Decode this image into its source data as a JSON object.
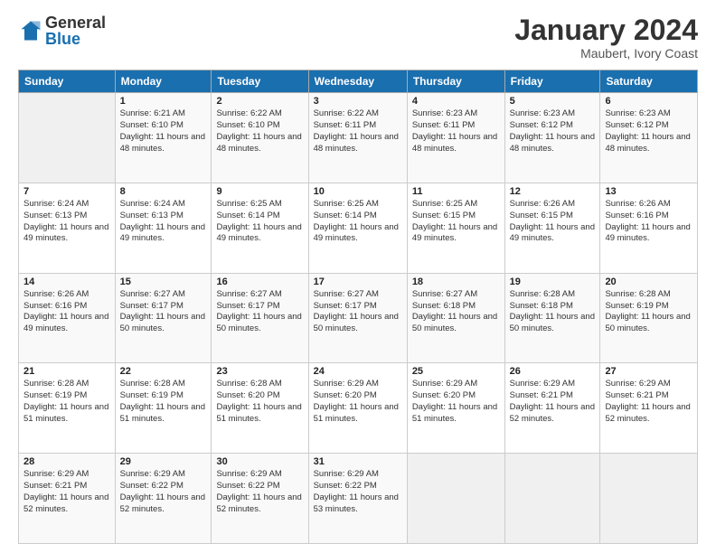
{
  "logo": {
    "general": "General",
    "blue": "Blue"
  },
  "title": "January 2024",
  "location": "Maubert, Ivory Coast",
  "days_of_week": [
    "Sunday",
    "Monday",
    "Tuesday",
    "Wednesday",
    "Thursday",
    "Friday",
    "Saturday"
  ],
  "weeks": [
    [
      {
        "day": "",
        "sunrise": "",
        "sunset": "",
        "daylight": ""
      },
      {
        "day": "1",
        "sunrise": "Sunrise: 6:21 AM",
        "sunset": "Sunset: 6:10 PM",
        "daylight": "Daylight: 11 hours and 48 minutes."
      },
      {
        "day": "2",
        "sunrise": "Sunrise: 6:22 AM",
        "sunset": "Sunset: 6:10 PM",
        "daylight": "Daylight: 11 hours and 48 minutes."
      },
      {
        "day": "3",
        "sunrise": "Sunrise: 6:22 AM",
        "sunset": "Sunset: 6:11 PM",
        "daylight": "Daylight: 11 hours and 48 minutes."
      },
      {
        "day": "4",
        "sunrise": "Sunrise: 6:23 AM",
        "sunset": "Sunset: 6:11 PM",
        "daylight": "Daylight: 11 hours and 48 minutes."
      },
      {
        "day": "5",
        "sunrise": "Sunrise: 6:23 AM",
        "sunset": "Sunset: 6:12 PM",
        "daylight": "Daylight: 11 hours and 48 minutes."
      },
      {
        "day": "6",
        "sunrise": "Sunrise: 6:23 AM",
        "sunset": "Sunset: 6:12 PM",
        "daylight": "Daylight: 11 hours and 48 minutes."
      }
    ],
    [
      {
        "day": "7",
        "sunrise": "Sunrise: 6:24 AM",
        "sunset": "Sunset: 6:13 PM",
        "daylight": "Daylight: 11 hours and 49 minutes."
      },
      {
        "day": "8",
        "sunrise": "Sunrise: 6:24 AM",
        "sunset": "Sunset: 6:13 PM",
        "daylight": "Daylight: 11 hours and 49 minutes."
      },
      {
        "day": "9",
        "sunrise": "Sunrise: 6:25 AM",
        "sunset": "Sunset: 6:14 PM",
        "daylight": "Daylight: 11 hours and 49 minutes."
      },
      {
        "day": "10",
        "sunrise": "Sunrise: 6:25 AM",
        "sunset": "Sunset: 6:14 PM",
        "daylight": "Daylight: 11 hours and 49 minutes."
      },
      {
        "day": "11",
        "sunrise": "Sunrise: 6:25 AM",
        "sunset": "Sunset: 6:15 PM",
        "daylight": "Daylight: 11 hours and 49 minutes."
      },
      {
        "day": "12",
        "sunrise": "Sunrise: 6:26 AM",
        "sunset": "Sunset: 6:15 PM",
        "daylight": "Daylight: 11 hours and 49 minutes."
      },
      {
        "day": "13",
        "sunrise": "Sunrise: 6:26 AM",
        "sunset": "Sunset: 6:16 PM",
        "daylight": "Daylight: 11 hours and 49 minutes."
      }
    ],
    [
      {
        "day": "14",
        "sunrise": "Sunrise: 6:26 AM",
        "sunset": "Sunset: 6:16 PM",
        "daylight": "Daylight: 11 hours and 49 minutes."
      },
      {
        "day": "15",
        "sunrise": "Sunrise: 6:27 AM",
        "sunset": "Sunset: 6:17 PM",
        "daylight": "Daylight: 11 hours and 50 minutes."
      },
      {
        "day": "16",
        "sunrise": "Sunrise: 6:27 AM",
        "sunset": "Sunset: 6:17 PM",
        "daylight": "Daylight: 11 hours and 50 minutes."
      },
      {
        "day": "17",
        "sunrise": "Sunrise: 6:27 AM",
        "sunset": "Sunset: 6:17 PM",
        "daylight": "Daylight: 11 hours and 50 minutes."
      },
      {
        "day": "18",
        "sunrise": "Sunrise: 6:27 AM",
        "sunset": "Sunset: 6:18 PM",
        "daylight": "Daylight: 11 hours and 50 minutes."
      },
      {
        "day": "19",
        "sunrise": "Sunrise: 6:28 AM",
        "sunset": "Sunset: 6:18 PM",
        "daylight": "Daylight: 11 hours and 50 minutes."
      },
      {
        "day": "20",
        "sunrise": "Sunrise: 6:28 AM",
        "sunset": "Sunset: 6:19 PM",
        "daylight": "Daylight: 11 hours and 50 minutes."
      }
    ],
    [
      {
        "day": "21",
        "sunrise": "Sunrise: 6:28 AM",
        "sunset": "Sunset: 6:19 PM",
        "daylight": "Daylight: 11 hours and 51 minutes."
      },
      {
        "day": "22",
        "sunrise": "Sunrise: 6:28 AM",
        "sunset": "Sunset: 6:19 PM",
        "daylight": "Daylight: 11 hours and 51 minutes."
      },
      {
        "day": "23",
        "sunrise": "Sunrise: 6:28 AM",
        "sunset": "Sunset: 6:20 PM",
        "daylight": "Daylight: 11 hours and 51 minutes."
      },
      {
        "day": "24",
        "sunrise": "Sunrise: 6:29 AM",
        "sunset": "Sunset: 6:20 PM",
        "daylight": "Daylight: 11 hours and 51 minutes."
      },
      {
        "day": "25",
        "sunrise": "Sunrise: 6:29 AM",
        "sunset": "Sunset: 6:20 PM",
        "daylight": "Daylight: 11 hours and 51 minutes."
      },
      {
        "day": "26",
        "sunrise": "Sunrise: 6:29 AM",
        "sunset": "Sunset: 6:21 PM",
        "daylight": "Daylight: 11 hours and 52 minutes."
      },
      {
        "day": "27",
        "sunrise": "Sunrise: 6:29 AM",
        "sunset": "Sunset: 6:21 PM",
        "daylight": "Daylight: 11 hours and 52 minutes."
      }
    ],
    [
      {
        "day": "28",
        "sunrise": "Sunrise: 6:29 AM",
        "sunset": "Sunset: 6:21 PM",
        "daylight": "Daylight: 11 hours and 52 minutes."
      },
      {
        "day": "29",
        "sunrise": "Sunrise: 6:29 AM",
        "sunset": "Sunset: 6:22 PM",
        "daylight": "Daylight: 11 hours and 52 minutes."
      },
      {
        "day": "30",
        "sunrise": "Sunrise: 6:29 AM",
        "sunset": "Sunset: 6:22 PM",
        "daylight": "Daylight: 11 hours and 52 minutes."
      },
      {
        "day": "31",
        "sunrise": "Sunrise: 6:29 AM",
        "sunset": "Sunset: 6:22 PM",
        "daylight": "Daylight: 11 hours and 53 minutes."
      },
      {
        "day": "",
        "sunrise": "",
        "sunset": "",
        "daylight": ""
      },
      {
        "day": "",
        "sunrise": "",
        "sunset": "",
        "daylight": ""
      },
      {
        "day": "",
        "sunrise": "",
        "sunset": "",
        "daylight": ""
      }
    ]
  ]
}
